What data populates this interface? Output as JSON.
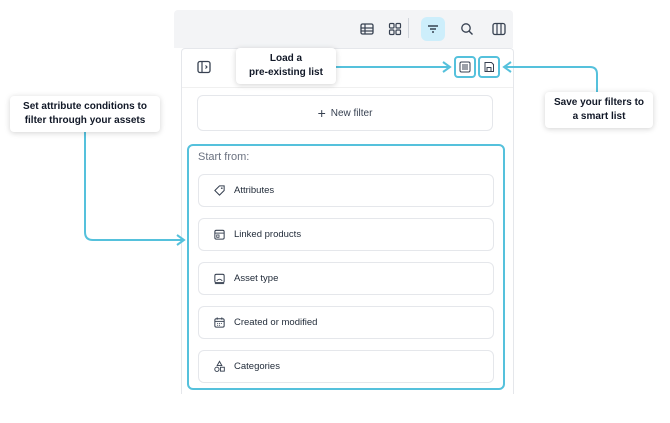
{
  "toolbar": {
    "items": [
      {
        "name": "table-view-button",
        "icon": "table-icon",
        "active": false
      },
      {
        "name": "grid-view-button",
        "icon": "grid-icon",
        "active": false
      },
      {
        "name": "filter-button",
        "icon": "filter-icon",
        "active": true
      },
      {
        "name": "search-button",
        "icon": "search-icon",
        "active": false
      },
      {
        "name": "columns-button",
        "icon": "columns-icon",
        "active": false
      }
    ]
  },
  "panel": {
    "sidebar_toggle_icon": "sidebar-icon",
    "load_list_icon": "list-icon",
    "save_list_icon": "save-icon",
    "new_filter_label": "New filter",
    "start_from_label": "Start from:",
    "options": [
      {
        "label": "Attributes",
        "icon": "tag-icon"
      },
      {
        "label": "Linked products",
        "icon": "calendar-box-icon"
      },
      {
        "label": "Asset type",
        "icon": "asset-icon"
      },
      {
        "label": "Created or modified",
        "icon": "calendar-icon"
      },
      {
        "label": "Categories",
        "icon": "shapes-icon"
      }
    ]
  },
  "callouts": {
    "load_list": [
      "Load a",
      "pre-existing list"
    ],
    "set_conditions": [
      "Set attribute conditions to",
      "filter through your assets"
    ],
    "save_filters": [
      "Save your filters to",
      "a smart list"
    ]
  },
  "colors": {
    "accent": "#55c1dc",
    "active_button_bg": "#cdeefb",
    "toolbar_bg": "#f3f4f6"
  }
}
